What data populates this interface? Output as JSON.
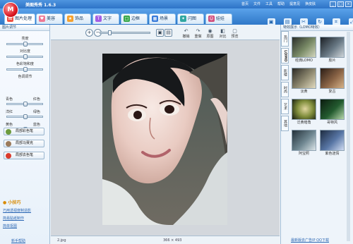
{
  "titlebar": {
    "title": "美图秀秀 1.6.3",
    "logo_text": "M"
  },
  "menu": [
    "首页",
    "文件",
    "工具",
    "帮助",
    "提意见",
    "换皮肤"
  ],
  "window_controls": [
    "_",
    "□",
    "×"
  ],
  "tabs": [
    {
      "label": "图片处理",
      "icon": "photo-icon",
      "color": "#ef4d3f"
    },
    {
      "label": "美容",
      "icon": "heart-icon",
      "color": "#ef7895"
    },
    {
      "label": "饰品",
      "icon": "star-icon",
      "color": "#f5a12e"
    },
    {
      "label": "文字",
      "icon": "text-icon",
      "color": "#a45de3"
    },
    {
      "label": "边框",
      "icon": "frame-icon",
      "color": "#38a84a"
    },
    {
      "label": "场景",
      "icon": "scene-icon",
      "color": "#3679d9"
    },
    {
      "label": "闪图",
      "icon": "flash-icon",
      "color": "#30a7a1"
    },
    {
      "label": "娃娃",
      "icon": "doll-icon",
      "color": "#d24c7c"
    }
  ],
  "toolbar": [
    {
      "label": "打开",
      "icon": "open-icon"
    },
    {
      "label": "保存",
      "icon": "save-icon"
    },
    {
      "label": "截图",
      "icon": "screenshot-icon"
    },
    {
      "label": "旋转",
      "icon": "rotate-icon"
    },
    {
      "label": "裁剪",
      "icon": "crop-icon"
    },
    {
      "label": "尺寸",
      "icon": "resize-icon"
    },
    {
      "label": "一键",
      "icon": "magic-icon"
    }
  ],
  "left_panel": {
    "title": "图片调节",
    "sliders": [
      {
        "label": "亮度",
        "value": 0.5
      },
      {
        "label": "对比度",
        "value": 0.5
      },
      {
        "label": "色彩饱和度",
        "value": 0.5
      },
      {
        "label": "色调调节",
        "value": 0.5
      }
    ],
    "color_balance": [
      {
        "left": "青色",
        "right": "红色",
        "value": 0.5
      },
      {
        "left": "洋红",
        "right": "绿色",
        "value": 0.5
      },
      {
        "left": "黄色",
        "right": "蓝色",
        "value": 0.5
      }
    ],
    "effect_buttons": [
      "局部彩色笔",
      "局部马赛克",
      "局部去色笔"
    ],
    "tips_title": "小技巧",
    "tips": [
      "巧用透视度制造影",
      "简易贴纸制作",
      "简单抠图"
    ],
    "bottom_link": "新手帮助"
  },
  "canvas": {
    "zoom": 0.16,
    "tools": [
      {
        "label": "撤销",
        "icon": "undo-icon"
      },
      {
        "label": "重做",
        "icon": "redo-icon"
      },
      {
        "label": "原图",
        "icon": "original-icon"
      },
      {
        "label": "对比",
        "icon": "compare-icon"
      },
      {
        "label": "预览",
        "icon": "preview-icon"
      }
    ],
    "status": {
      "filename": "2.jpg",
      "dimensions": "366 × 493"
    }
  },
  "right_panel": {
    "title": "特效展示（LOMO特效）",
    "vtabs": [
      "热门",
      "LOMO",
      "影楼",
      "时尚",
      "艺术",
      "其他"
    ],
    "effects": [
      {
        "label": "经典LOMO",
        "color": "#5a6d58"
      },
      {
        "label": "胶片",
        "color": "#4f5d69"
      },
      {
        "label": "淡黄",
        "color": "#6e6a59"
      },
      {
        "label": "复古",
        "color": "#775a43"
      },
      {
        "label": "泛黄暗角",
        "color": "#5e6c3e"
      },
      {
        "label": "哥特风",
        "color": "#245d2f"
      },
      {
        "label": "阿宝照",
        "color": "#5c6d74"
      },
      {
        "label": "紫色迷情",
        "color": "#536f91"
      }
    ],
    "footer": "最新版去广告IP QQ下载"
  }
}
